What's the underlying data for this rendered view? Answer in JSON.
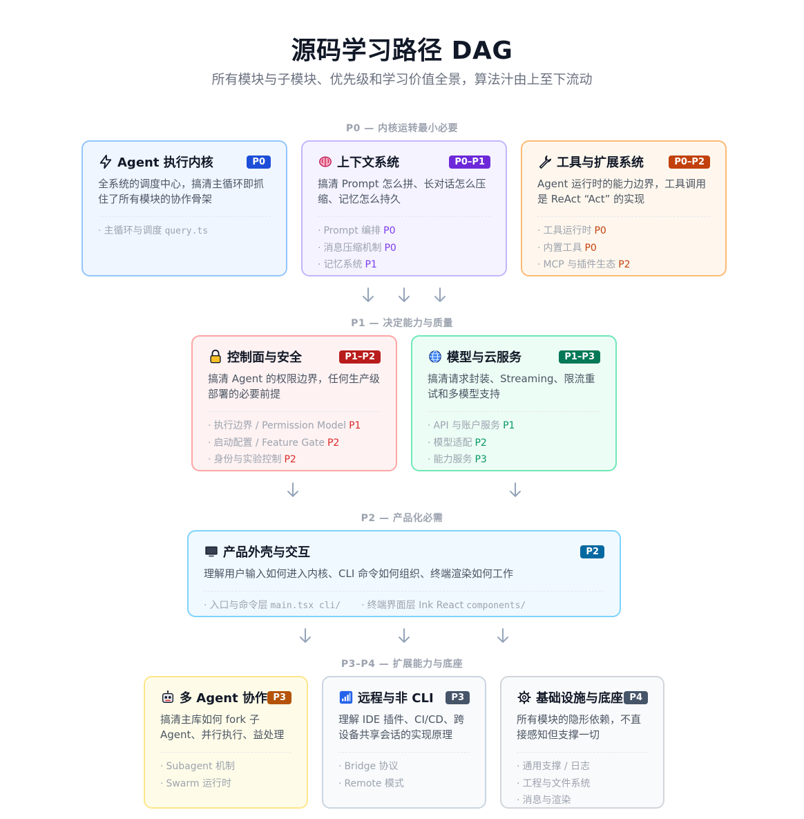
{
  "header": {
    "title": "源码学习路径 DAG",
    "subtitle": "所有模块与子模块、优先级和学习价值全景，算法汁由上至下流动"
  },
  "tiers": [
    {
      "label": "P0 — 内核运转最小必要"
    },
    {
      "label": "P1 — 决定能力与质量"
    },
    {
      "label": "P2 — 产品化必需"
    },
    {
      "label": "P3–P4 — 扩展能力与底座"
    }
  ],
  "colors": {
    "badge_blue": "#1d4ed8",
    "badge_purple": "#6d28d9",
    "badge_orange": "#c2410c",
    "badge_red": "#b91c1c",
    "badge_green": "#047857",
    "badge_sky": "#0369a1",
    "badge_amber": "#b45309",
    "badge_slate": "#475569"
  },
  "cards": {
    "agent_core": {
      "icon": "lightning-icon",
      "title": "Agent 执行内核",
      "badge": "P0",
      "desc": "全系统的调度中心，搞清主循环即抓住了所有模块的协作骨架",
      "items": [
        {
          "label": "主循环与调度",
          "code": "query.ts"
        }
      ]
    },
    "context": {
      "icon": "brain-icon",
      "title": "上下文系统",
      "badge": "P0–P1",
      "desc": "搞清 Prompt 怎么拼、长对话怎么压缩、记忆怎么持久",
      "items": [
        {
          "label": "Prompt 编排",
          "priority": "P0"
        },
        {
          "label": "消息压缩机制",
          "priority": "P0"
        },
        {
          "label": "记忆系统",
          "priority": "P1"
        }
      ]
    },
    "tools": {
      "icon": "wrench-icon",
      "title": "工具与扩展系统",
      "badge": "P0–P2",
      "desc": "Agent 运行时的能力边界，工具调用是 ReAct “Act” 的实现",
      "items": [
        {
          "label": "工具运行时",
          "priority": "P0"
        },
        {
          "label": "内置工具",
          "priority": "P0"
        },
        {
          "label": "MCP 与插件生态",
          "priority": "P2"
        }
      ]
    },
    "control": {
      "icon": "lock-icon",
      "title": "控制面与安全",
      "badge": "P1–P2",
      "desc": "搞清 Agent 的权限边界，任何生产级部署的必要前提",
      "items": [
        {
          "label": "执行边界 / Permission Model",
          "priority": "P1"
        },
        {
          "label": "启动配置 / Feature Gate",
          "priority": "P2"
        },
        {
          "label": "身份与实验控制",
          "priority": "P2"
        }
      ]
    },
    "models": {
      "icon": "globe-icon",
      "title": "模型与云服务",
      "badge": "P1–P3",
      "desc": "搞清请求封装、Streaming、限流重试和多模型支持",
      "items": [
        {
          "label": "API 与账户服务",
          "priority": "P1"
        },
        {
          "label": "模型适配",
          "priority": "P2"
        },
        {
          "label": "能力服务",
          "priority": "P3"
        }
      ]
    },
    "shell": {
      "icon": "monitor-icon",
      "title": "产品外壳与交互",
      "badge": "P2",
      "desc": "理解用户输入如何进入内核、CLI 命令如何组织、终端渲染如何工作",
      "items": [
        {
          "label": "入口与命令层",
          "code": "main.tsx cli/"
        },
        {
          "label": "终端界面层 Ink React",
          "code": "components/"
        }
      ]
    },
    "multi_agent": {
      "icon": "robot-icon",
      "title": "多 Agent 协作",
      "badge": "P3",
      "desc": "搞清主库如何 fork 子 Agent、并行执行、益处理",
      "items": [
        {
          "label": "Subagent 机制"
        },
        {
          "label": "Swarm 运行时"
        }
      ]
    },
    "remote": {
      "icon": "signal-icon",
      "title": "远程与非 CLI",
      "badge": "P3",
      "desc": "理解 IDE 插件、CI/CD、跨设备共享会话的实现原理",
      "items": [
        {
          "label": "Bridge 协议"
        },
        {
          "label": "Remote 模式"
        }
      ]
    },
    "infra": {
      "icon": "gear-icon",
      "title": "基础设施与底座",
      "badge": "P4",
      "desc": "所有模块的隐形依赖，不直接感知但支撑一切",
      "items": [
        {
          "label": "通用支撑 / 日志"
        },
        {
          "label": "工程与文件系统"
        },
        {
          "label": "消息与渲染"
        }
      ]
    }
  }
}
